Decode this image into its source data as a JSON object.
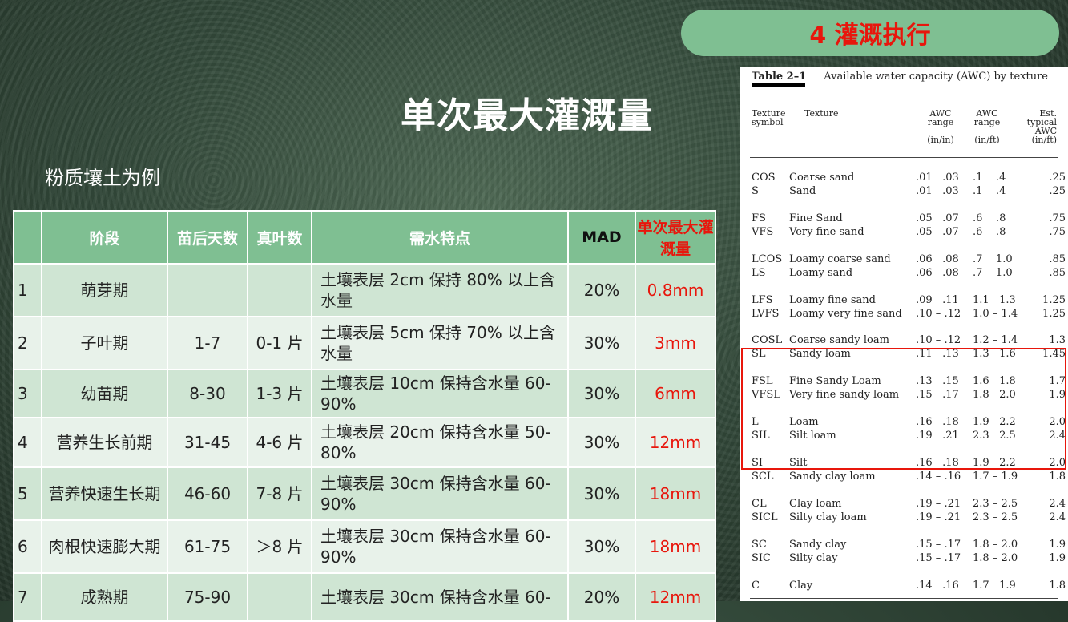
{
  "section_badge": "4 灌溉执行",
  "title": "单次最大灌溉量",
  "subtitle": "粉质壤土为例",
  "table": {
    "headers": [
      "",
      "阶段",
      "苗后天数",
      "真叶数",
      "需水特点",
      "MAD",
      "单次最大灌溉量"
    ],
    "rows": [
      {
        "no": "1",
        "stage": "萌芽期",
        "days": "",
        "leaves": "",
        "need": "土壤表层 2cm 保持 80% 以上含水量",
        "mad": "20%",
        "max": "0.8mm"
      },
      {
        "no": "2",
        "stage": "子叶期",
        "days": "1-7",
        "leaves": "0-1 片",
        "need": "土壤表层 5cm 保持 70% 以上含水量",
        "mad": "30%",
        "max": "3mm"
      },
      {
        "no": "3",
        "stage": "幼苗期",
        "days": "8-30",
        "leaves": "1-3 片",
        "need": "土壤表层 10cm 保持含水量 60-90%",
        "mad": "30%",
        "max": "6mm"
      },
      {
        "no": "4",
        "stage": "营养生长前期",
        "days": "31-45",
        "leaves": "4-6 片",
        "need": "土壤表层 20cm 保持含水量 50-80%",
        "mad": "30%",
        "max": "12mm"
      },
      {
        "no": "5",
        "stage": "营养快速生长期",
        "days": "46-60",
        "leaves": "7-8 片",
        "need": "土壤表层 30cm 保持含水量 60-90%",
        "mad": "30%",
        "max": "18mm"
      },
      {
        "no": "6",
        "stage": "肉根快速膨大期",
        "days": "61-75",
        "leaves": "＞8 片",
        "need": "土壤表层 30cm 保持含水量 60-90%",
        "mad": "30%",
        "max": "18mm"
      },
      {
        "no": "7",
        "stage": "成熟期",
        "days": "75-90",
        "leaves": "",
        "need": "土壤表层 30cm 保持含水量 60-",
        "mad": "20%",
        "max": "12mm"
      }
    ]
  },
  "reference": {
    "table_label": "Table 2–1",
    "caption": "Available water capacity (AWC) by texture",
    "headers": {
      "symbol": [
        "Texture",
        "symbol"
      ],
      "texture": "Texture",
      "awc_inin": [
        "AWC",
        "range",
        "",
        "(in/in)"
      ],
      "awc_inft": [
        "AWC",
        "range",
        "",
        "(in/ft)"
      ],
      "typical": [
        "Est.",
        "typical",
        "AWC",
        "(in/ft)"
      ]
    },
    "rows": [
      {
        "sym": "COS",
        "tex": "Coarse sand",
        "r1": ".01   .03",
        "r2": ".1    .4",
        "t": ".25"
      },
      {
        "sym": "S",
        "tex": "Sand",
        "r1": ".01   .03",
        "r2": ".1    .4",
        "t": ".25"
      },
      {
        "sym": "FS",
        "tex": "Fine Sand",
        "r1": ".05   .07",
        "r2": ".6    .8",
        "t": ".75"
      },
      {
        "sym": "VFS",
        "tex": "Very fine sand",
        "r1": ".05   .07",
        "r2": ".6    .8",
        "t": ".75"
      },
      {
        "sym": "LCOS",
        "tex": "Loamy coarse sand",
        "r1": ".06   .08",
        "r2": ".7    1.0",
        "t": ".85"
      },
      {
        "sym": "LS",
        "tex": "Loamy sand",
        "r1": ".06   .08",
        "r2": ".7    1.0",
        "t": ".85"
      },
      {
        "sym": "LFS",
        "tex": "Loamy fine sand",
        "r1": ".09   .11",
        "r2": "1.1   1.3",
        "t": "1.25"
      },
      {
        "sym": "LVFS",
        "tex": "Loamy very fine sand",
        "r1": ".10 – .12",
        "r2": "1.0 – 1.4",
        "t": "1.25"
      },
      {
        "sym": "COSL",
        "tex": "Coarse sandy loam",
        "r1": ".10 – .12",
        "r2": "1.2 – 1.4",
        "t": "1.3"
      },
      {
        "sym": "SL",
        "tex": "Sandy loam",
        "r1": ".11   .13",
        "r2": "1.3   1.6",
        "t": "1.45"
      },
      {
        "sym": "FSL",
        "tex": "Fine Sandy Loam",
        "r1": ".13   .15",
        "r2": "1.6   1.8",
        "t": "1.7"
      },
      {
        "sym": "VFSL",
        "tex": "Very fine sandy loam",
        "r1": ".15   .17",
        "r2": "1.8   2.0",
        "t": "1.9"
      },
      {
        "sym": "L",
        "tex": "Loam",
        "r1": ".16   .18",
        "r2": "1.9   2.2",
        "t": "2.0"
      },
      {
        "sym": "SIL",
        "tex": "Silt loam",
        "r1": ".19   .21",
        "r2": "2.3   2.5",
        "t": "2.4"
      },
      {
        "sym": "SI",
        "tex": "Silt",
        "r1": ".16   .18",
        "r2": "1.9   2.2",
        "t": "2.0"
      },
      {
        "sym": "SCL",
        "tex": "Sandy clay loam",
        "r1": ".14 – .16",
        "r2": "1.7 – 1.9",
        "t": "1.8"
      },
      {
        "sym": "CL",
        "tex": "Clay loam",
        "r1": ".19 – .21",
        "r2": "2.3 – 2.5",
        "t": "2.4"
      },
      {
        "sym": "SICL",
        "tex": "Silty clay loam",
        "r1": ".19 – .21",
        "r2": "2.3 – 2.5",
        "t": "2.4"
      },
      {
        "sym": "SC",
        "tex": "Sandy clay",
        "r1": ".15 – .17",
        "r2": "1.8 – 2.0",
        "t": "1.9"
      },
      {
        "sym": "SIC",
        "tex": "Silty clay",
        "r1": ".15 – .17",
        "r2": "1.8 – 2.0",
        "t": "1.9"
      },
      {
        "sym": "C",
        "tex": "Clay",
        "r1": ".14   .16",
        "r2": "1.7   1.9",
        "t": "1.8"
      }
    ]
  },
  "colors": {
    "accent_green": "#7fbf92",
    "highlight_red": "#e8160c",
    "row_odd": "#cfe5d3",
    "row_even": "#e8f2ea"
  }
}
